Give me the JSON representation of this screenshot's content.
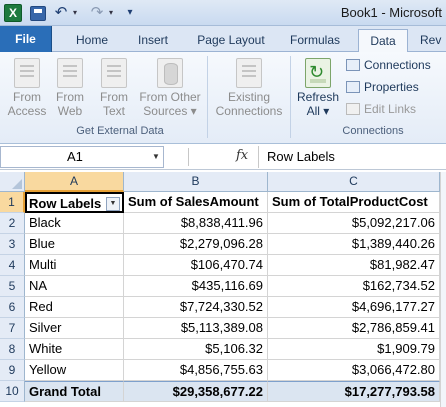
{
  "window": {
    "title": "Book1 - Microsoft"
  },
  "quick_access": {
    "app_icon": "excel-icon",
    "save": "save-icon",
    "undo": "↶",
    "redo": "↷",
    "dropdown": "▾",
    "customize": "▾"
  },
  "tabs": [
    {
      "label": "File"
    },
    {
      "label": "Home"
    },
    {
      "label": "Insert"
    },
    {
      "label": "Page Layout"
    },
    {
      "label": "Formulas"
    },
    {
      "label": "Data",
      "active": true
    },
    {
      "label": "Rev"
    }
  ],
  "ribbon": {
    "external_data": {
      "label": "Get External Data",
      "buttons": [
        {
          "line1": "From",
          "line2": "Access"
        },
        {
          "line1": "From",
          "line2": "Web"
        },
        {
          "line1": "From",
          "line2": "Text"
        },
        {
          "line1": "From Other",
          "line2": "Sources ▾"
        },
        {
          "line1": "Existing",
          "line2": "Connections"
        }
      ]
    },
    "connections": {
      "label": "Connections",
      "refresh": {
        "line1": "Refresh",
        "line2": "All ▾"
      },
      "connections_label": "Connections",
      "properties_label": "Properties",
      "edit_links_label": "Edit Links"
    }
  },
  "formula_bar": {
    "name_box": "A1",
    "fx": "fx",
    "value": "Row Labels",
    "dropdown": "▼"
  },
  "sheet": {
    "columns": [
      "A",
      "B",
      "C"
    ],
    "selected_column": "A",
    "rows": [
      {
        "num": "1",
        "a": "Row Labels",
        "b": "Sum of SalesAmount",
        "c": "Sum of TotalProductCost"
      },
      {
        "num": "2",
        "a": "Black",
        "b": "$8,838,411.96",
        "c": "$5,092,217.06"
      },
      {
        "num": "3",
        "a": "Blue",
        "b": "$2,279,096.28",
        "c": "$1,389,440.26"
      },
      {
        "num": "4",
        "a": "Multi",
        "b": "$106,470.74",
        "c": "$81,982.47"
      },
      {
        "num": "5",
        "a": "NA",
        "b": "$435,116.69",
        "c": "$162,734.52"
      },
      {
        "num": "6",
        "a": "Red",
        "b": "$7,724,330.52",
        "c": "$4,696,177.27"
      },
      {
        "num": "7",
        "a": "Silver",
        "b": "$5,113,389.08",
        "c": "$2,786,859.41"
      },
      {
        "num": "8",
        "a": "White",
        "b": "$5,106.32",
        "c": "$1,909.79"
      },
      {
        "num": "9",
        "a": "Yellow",
        "b": "$4,856,755.63",
        "c": "$3,066,472.80"
      },
      {
        "num": "10",
        "a": "Grand Total",
        "b": "$29,358,677.22",
        "c": "$17,277,793.58"
      }
    ]
  }
}
